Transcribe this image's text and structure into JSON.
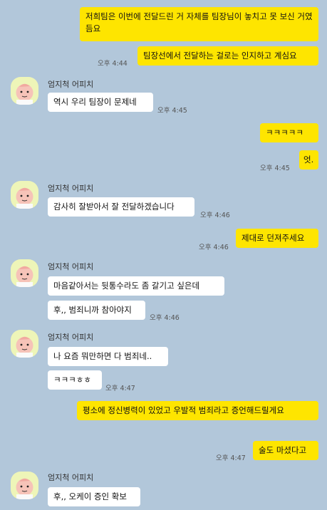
{
  "sender_name": "엄지척 어피치",
  "messages": [
    {
      "text": "저희팀은 이번에 전달드린 거 자체를 팀장님이 놓치고 못 보신 거였듬요",
      "time": "오후 4:44"
    },
    {
      "text": "팀장선에서 전달하는 걸로는 인지하고 계심요"
    },
    {
      "text": "역시 우리 팀장이 문제네",
      "time": "오후 4:45"
    },
    {
      "text": "ㅋㅋㅋㅋㅋ"
    },
    {
      "text": "엇.",
      "time": "오후 4:45"
    },
    {
      "text": "감사히 잘받아서 잘 전달하겠습니다",
      "time": "오후 4:46"
    },
    {
      "text": "제대로 던져주세요",
      "time": "오후 4:46"
    },
    {
      "text": "마음같아서는 뒷통수라도 좀 갈기고 싶은데"
    },
    {
      "text": "후,, 범죄니까 참아야지",
      "time": "오후 4:46"
    },
    {
      "text": "나 요즘 뭐만하면 다 범죄네.."
    },
    {
      "text": "ㅋㅋㅋㅎㅎ",
      "time": "오후 4:47"
    },
    {
      "text": "평소에 정신병력이 있었고 우발적 범죄라고 증언해드릴게요"
    },
    {
      "text": "술도 마셨다고",
      "time": "오후 4:47"
    },
    {
      "text": "후,, 오케이 증인 확보"
    }
  ]
}
